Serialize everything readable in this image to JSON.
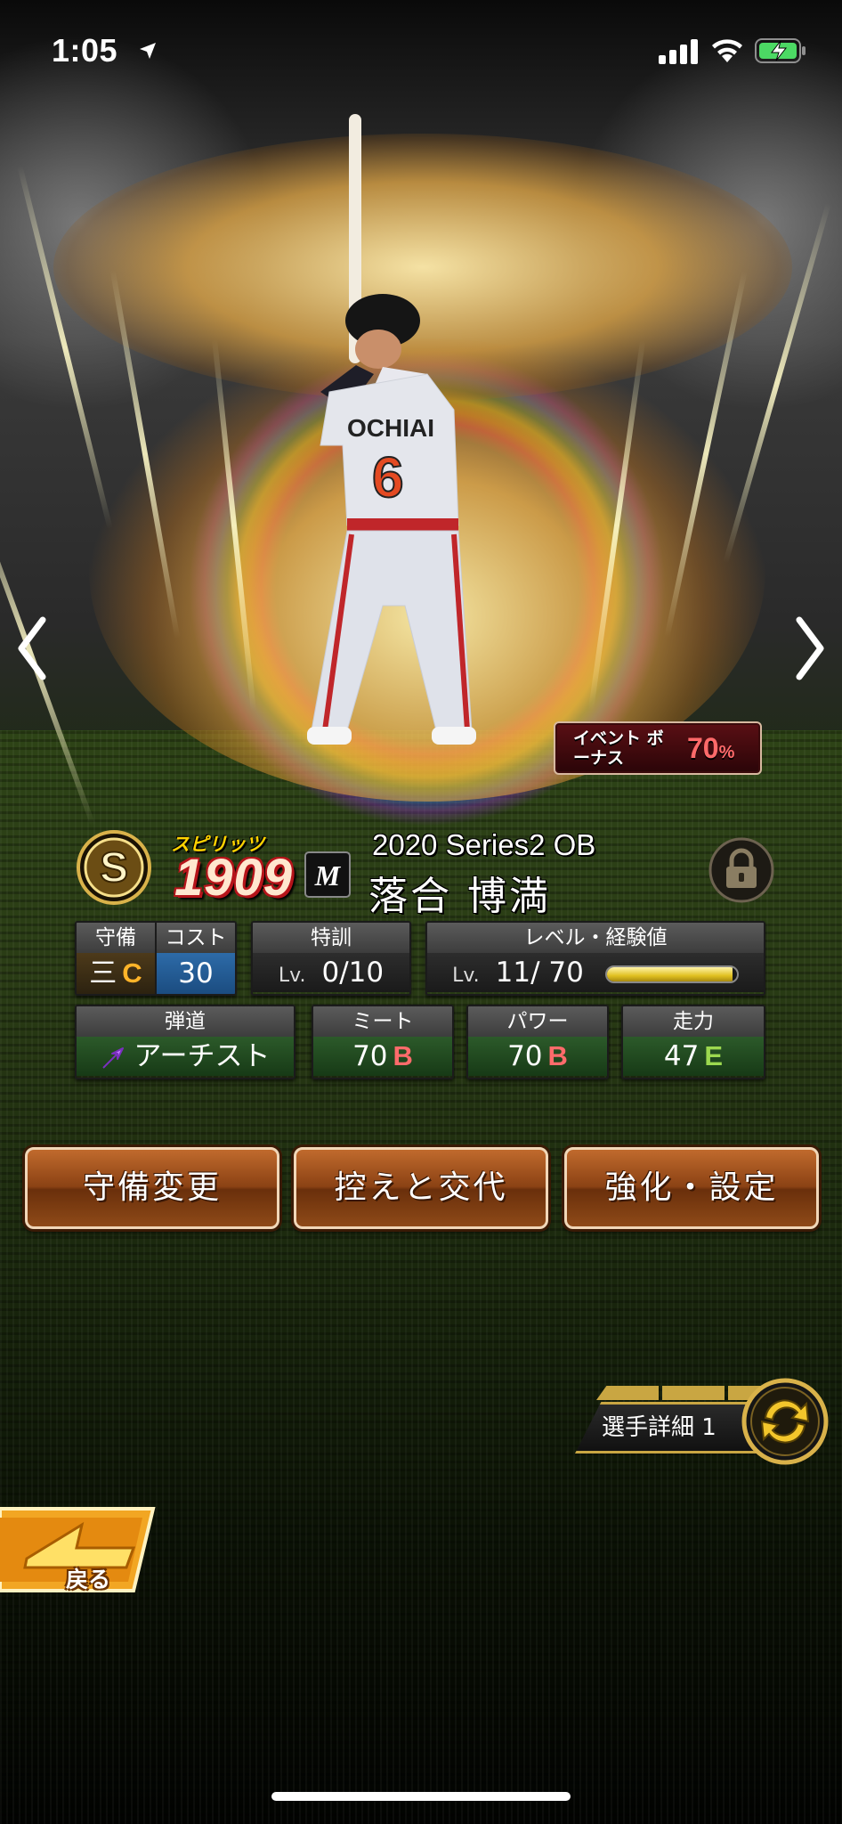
{
  "status_bar": {
    "time": "1:05"
  },
  "event_bonus": {
    "label": "イベント ボーナス",
    "value": "70",
    "unit": "%"
  },
  "header": {
    "rank": "S",
    "spirits_label": "スピリッツ",
    "spirits_value": "1909",
    "team_logo_letter": "M",
    "series": "2020 Series2 OB",
    "player_name": "落合 博満"
  },
  "stats": {
    "position_head": "守備",
    "cost_head": "コスト",
    "position_value": "三",
    "position_grade": "C",
    "cost_value": "30",
    "training_head": "特訓",
    "training_lv": "Lv.",
    "training_value": "0/10",
    "level_head": "レベル・経験値",
    "level_lv": "Lv.",
    "level_value": "11/ 70",
    "exp_fraction": 0.97,
    "trajectory_head": "弾道",
    "trajectory_value": "アーチスト",
    "contact_head": "ミート",
    "contact_value": "70",
    "contact_grade": "B",
    "power_head": "パワー",
    "power_value": "70",
    "power_grade": "B",
    "speed_head": "走力",
    "speed_value": "47",
    "speed_grade": "E"
  },
  "buttons": {
    "position_change": "守備変更",
    "substitute": "控えと交代",
    "enhance": "強化・設定"
  },
  "detail": {
    "label": "選手詳細 1"
  },
  "back": {
    "label": "戻る"
  },
  "player_figure": {
    "jersey_name": "OCHIAI",
    "jersey_number": "6"
  }
}
